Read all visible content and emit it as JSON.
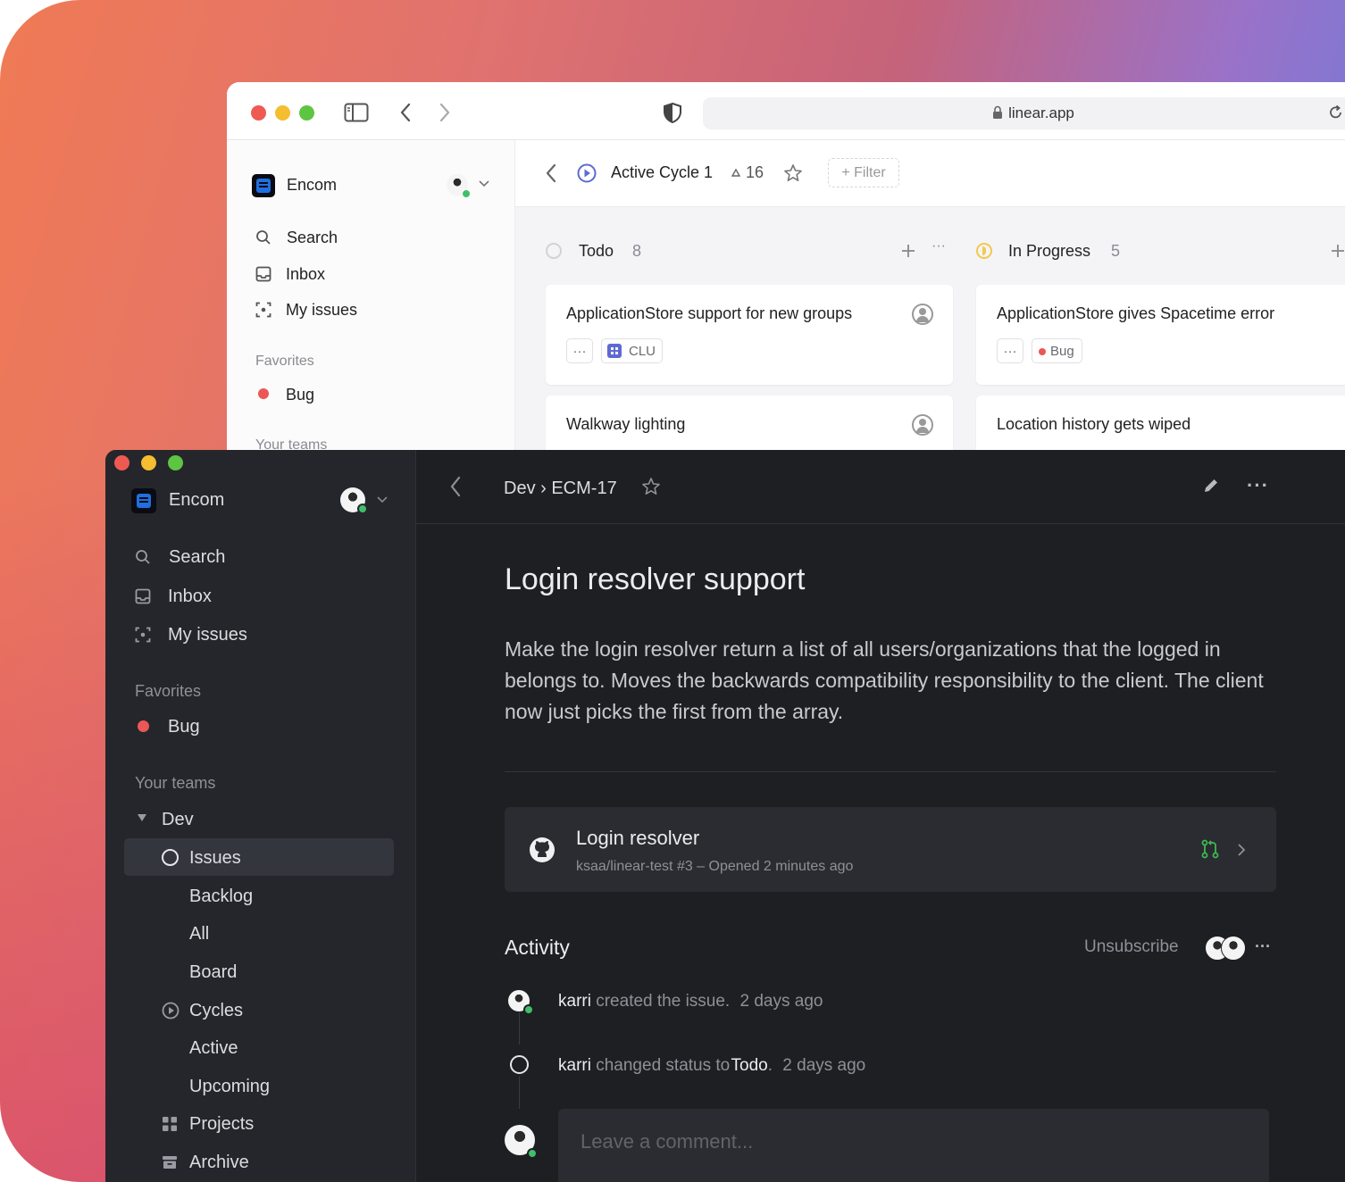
{
  "browser": {
    "url": "linear.app"
  },
  "light": {
    "workspace": "Encom",
    "nav": {
      "search": "Search",
      "inbox": "Inbox",
      "my_issues": "My issues"
    },
    "favorites_label": "Favorites",
    "favorite_bug": "Bug",
    "your_teams": "Your teams",
    "header": {
      "title": "Active Cycle 1",
      "count": "16",
      "filter": "+ Filter"
    },
    "columns": [
      {
        "name": "Todo",
        "count": "8",
        "cards": [
          {
            "title": "ApplicationStore support for new groups",
            "label": "CLU"
          },
          {
            "title": "Walkway lighting"
          }
        ]
      },
      {
        "name": "In Progress",
        "count": "5",
        "cards": [
          {
            "title": "ApplicationStore gives Spacetime error",
            "label": "Bug"
          },
          {
            "title": "Location history gets wiped"
          }
        ]
      }
    ]
  },
  "dark": {
    "workspace": "Encom",
    "nav": {
      "search": "Search",
      "inbox": "Inbox",
      "my_issues": "My issues"
    },
    "favorites_label": "Favorites",
    "favorite_bug": "Bug",
    "your_teams": "Your teams",
    "team": "Dev",
    "team_items": {
      "issues": "Issues",
      "backlog": "Backlog",
      "all": "All",
      "board": "Board",
      "cycles": "Cycles",
      "active": "Active",
      "upcoming": "Upcoming",
      "projects": "Projects",
      "archive": "Archive"
    },
    "breadcrumb": "Dev › ECM-17",
    "issue": {
      "title": "Login resolver support",
      "description": "Make the login resolver return a list of all users/organizations that the logged in belongs to. Moves the backwards compatibility responsibility to the client. The client now just picks the first from the array."
    },
    "pr": {
      "title": "Login resolver",
      "subtitle": "ksaa/linear-test #3 – Opened 2 minutes ago"
    },
    "activity": {
      "heading": "Activity",
      "unsubscribe": "Unsubscribe",
      "events": [
        {
          "user": "karri",
          "action": "created the issue.",
          "target": "",
          "time": "2 days ago"
        },
        {
          "user": "karri",
          "action": "changed status to",
          "target": "Todo",
          "time": "2 days ago"
        }
      ],
      "comment_placeholder": "Leave a comment..."
    }
  },
  "colors": {
    "accent": "#5e6ad2",
    "bug": "#eb5757",
    "in_progress": "#f2c94c",
    "pr_green": "#3fb950"
  }
}
